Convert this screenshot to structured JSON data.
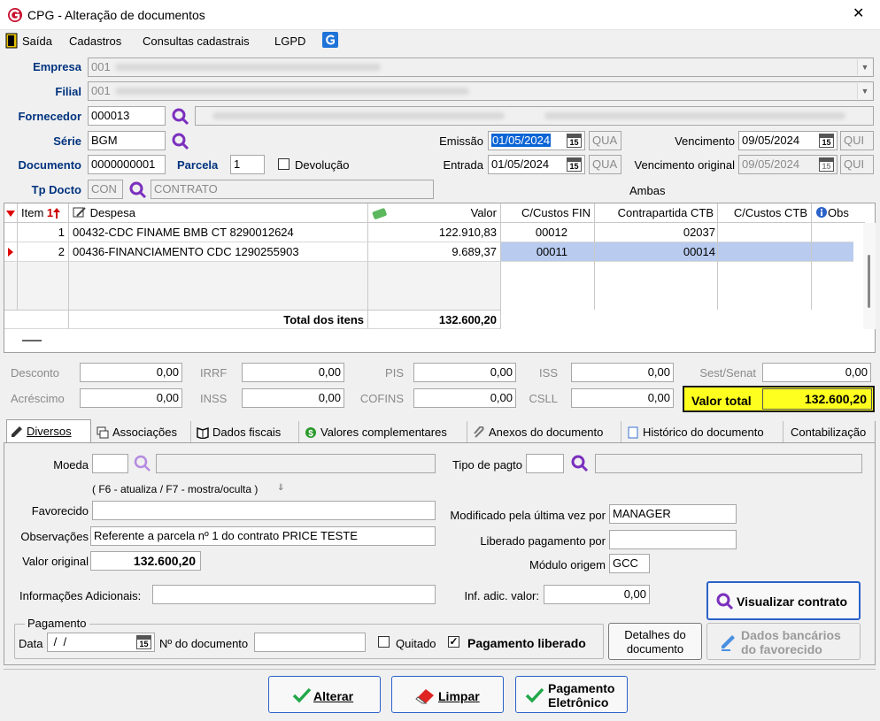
{
  "window": {
    "title": "CPG - Alteração de documentos",
    "close_glyph": "✕"
  },
  "menu": {
    "items": [
      "Saída",
      "Cadastros",
      "Consultas cadastrais",
      "LGPD"
    ]
  },
  "header": {
    "empresa_label": "Empresa",
    "empresa_code": "001",
    "filial_label": "Filial",
    "filial_code": "001",
    "fornecedor_label": "Fornecedor",
    "fornecedor_code": "000013",
    "serie_label": "Série",
    "serie_value": "BGM",
    "documento_label": "Documento",
    "documento_value": "0000000001",
    "parcela_label": "Parcela",
    "parcela_value": "1",
    "devolucao_label": "Devolução",
    "tpdocto_label": "Tp Docto",
    "tpdocto_code": "CON",
    "tpdocto_desc": "CONTRATO",
    "emissao_label": "Emissão",
    "emissao_value": "01/05/2024",
    "emissao_day": "QUA",
    "entrada_label": "Entrada",
    "entrada_value": "01/05/2024",
    "entrada_day": "QUA",
    "vencimento_label": "Vencimento",
    "vencimento_value": "09/05/2024",
    "vencimento_day": "QUI",
    "venc_original_label": "Vencimento original",
    "venc_original_value": "09/05/2024",
    "venc_original_day": "QUI",
    "ambas_label": "Ambas",
    "cal_glyph": "15"
  },
  "grid": {
    "headers": {
      "item": "Item",
      "item_sort": "1",
      "despesa": "Despesa",
      "valor": "Valor",
      "ccfin": "C/Custos FIN",
      "contra": "Contrapartida CTB",
      "ccctb": "C/Custos CTB",
      "obs": "Obs"
    },
    "rows": [
      {
        "item": "1",
        "despesa": "00432-CDC FINAME BMB CT 8290012624",
        "valor": "122.910,83",
        "ccfin": "00012",
        "contra": "02037"
      },
      {
        "item": "2",
        "despesa": "00436-FINANCIAMENTO CDC 1290255903",
        "valor": "9.689,37",
        "ccfin": "00011",
        "contra": "00014"
      }
    ],
    "total_label": "Total dos itens",
    "total_value": "132.600,20"
  },
  "taxes": {
    "desconto_label": "Desconto",
    "desconto": "0,00",
    "acrescimo_label": "Acréscimo",
    "acrescimo": "0,00",
    "irrf_label": "IRRF",
    "irrf": "0,00",
    "inss_label": "INSS",
    "inss": "0,00",
    "pis_label": "PIS",
    "pis": "0,00",
    "cofins_label": "COFINS",
    "cofins": "0,00",
    "iss_label": "ISS",
    "iss": "0,00",
    "csll_label": "CSLL",
    "csll": "0,00",
    "sest_label": "Sest/Senat",
    "sest": "0,00",
    "valor_total_label": "Valor total",
    "valor_total": "132.600,20"
  },
  "tabs": [
    "Diversos",
    "Associações",
    "Dados fiscais",
    "Valores complementares",
    "Anexos do documento",
    "Histórico do documento",
    "Contabilização"
  ],
  "diversos": {
    "moeda_label": "Moeda",
    "hint": "( F6 - atualiza / F7 - mostra/oculta )",
    "tipo_pagto_label": "Tipo de pagto",
    "favorecido_label": "Favorecido",
    "observacoes_label": "Observações",
    "observacoes_value": "Referente a parcela nº 1 do contrato PRICE TESTE",
    "valor_original_label": "Valor original",
    "valor_original_value": "132.600,20",
    "modificado_label": "Modificado pela última vez por",
    "modificado_value": "MANAGER",
    "liberado_label": "Liberado pagamento por",
    "modulo_label": "Módulo origem",
    "modulo_value": "GCC",
    "info_adic_label": "Informações Adicionais:",
    "inf_adic_valor_label": "Inf. adic. valor:",
    "inf_adic_valor_value": "0,00",
    "visualizar_btn": "Visualizar contrato",
    "pagamento_group": "Pagamento",
    "data_label": "Data",
    "data_value": " /  /",
    "ndoc_label": "Nº do documento",
    "quitado_label": "Quitado",
    "pag_liberado_label": "Pagamento liberado",
    "detalhes_btn_1": "Detalhes do",
    "detalhes_btn_2": "documento",
    "dados_banc_1": "Dados bancários",
    "dados_banc_2": "do favorecido"
  },
  "footer": {
    "alterar": "Alterar",
    "limpar": "Limpar",
    "pag_eletronico_1": "Pagamento",
    "pag_eletronico_2": "Eletrônico"
  }
}
